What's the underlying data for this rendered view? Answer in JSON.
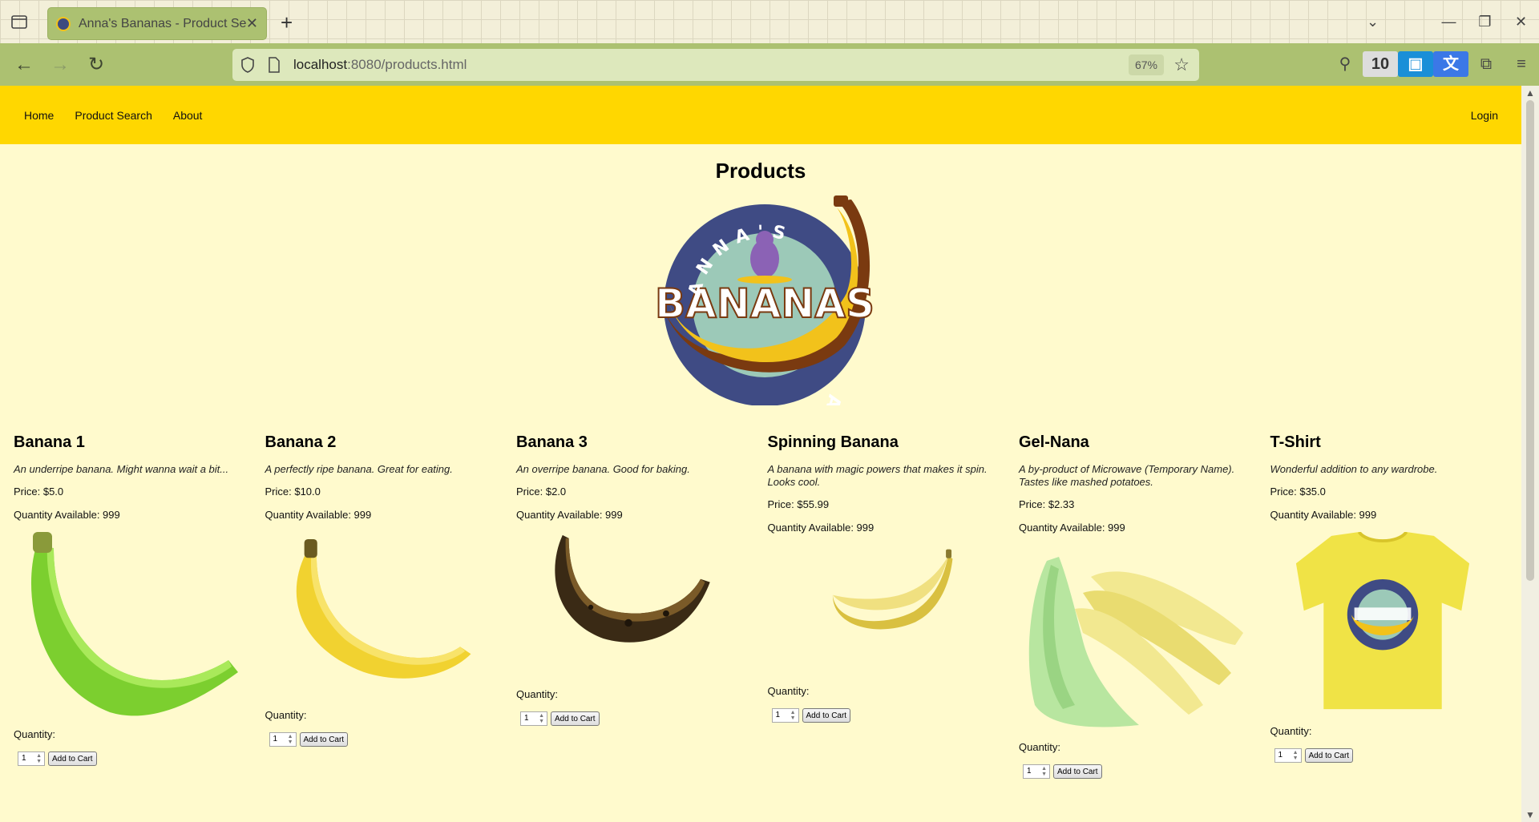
{
  "browser": {
    "tab_title": "Anna's Bananas - Product Search",
    "tab_close": "✕",
    "new_tab": "+",
    "url_host": "localhost",
    "url_rest": ":8080/products.html",
    "zoom": "67%"
  },
  "site_nav": {
    "links": [
      "Home",
      "Product Search",
      "About"
    ],
    "login": "Login"
  },
  "page": {
    "title": "Products"
  },
  "logo": {
    "top_text": "ANNA'S",
    "main_text": "BANANAS",
    "bottom_text": "ANNA'S"
  },
  "products": [
    {
      "name": "Banana 1",
      "description": "An underripe banana. Might wanna wait a bit...",
      "price": "Price: $5.0",
      "quantity_available": "Quantity Available: 999",
      "image": "green-banana",
      "quantity_label": "Quantity:",
      "quantity_value": "1",
      "button": "Add to Cart"
    },
    {
      "name": "Banana 2",
      "description": "A perfectly ripe banana. Great for eating.",
      "price": "Price: $10.0",
      "quantity_available": "Quantity Available: 999",
      "image": "ripe-banana",
      "quantity_label": "Quantity:",
      "quantity_value": "1",
      "button": "Add to Cart"
    },
    {
      "name": "Banana 3",
      "description": "An overripe banana. Good for baking.",
      "price": "Price: $2.0",
      "quantity_available": "Quantity Available: 999",
      "image": "overripe-banana",
      "quantity_label": "Quantity:",
      "quantity_value": "1",
      "button": "Add to Cart"
    },
    {
      "name": "Spinning Banana",
      "description": "A banana with magic powers that makes it spin. Looks cool.",
      "price": "Price: $55.99",
      "quantity_available": "Quantity Available: 999",
      "image": "spinning-banana",
      "quantity_label": "Quantity:",
      "quantity_value": "1",
      "button": "Add to Cart"
    },
    {
      "name": "Gel-Nana",
      "description": "A by-product of Microwave (Temporary Name). Tastes like mashed potatoes.",
      "price": "Price: $2.33",
      "quantity_available": "Quantity Available: 999",
      "image": "gel-nana",
      "quantity_label": "Quantity:",
      "quantity_value": "1",
      "button": "Add to Cart"
    },
    {
      "name": "T-Shirt",
      "description": "Wonderful addition to any wardrobe.",
      "price": "Price: $35.0",
      "quantity_available": "Quantity Available: 999",
      "image": "t-shirt",
      "quantity_label": "Quantity:",
      "quantity_value": "1",
      "button": "Add to Cart"
    }
  ],
  "colors": {
    "page_bg": "#fffacd",
    "nav_bg": "#ffd700",
    "browser_toolbar": "#acc171"
  }
}
